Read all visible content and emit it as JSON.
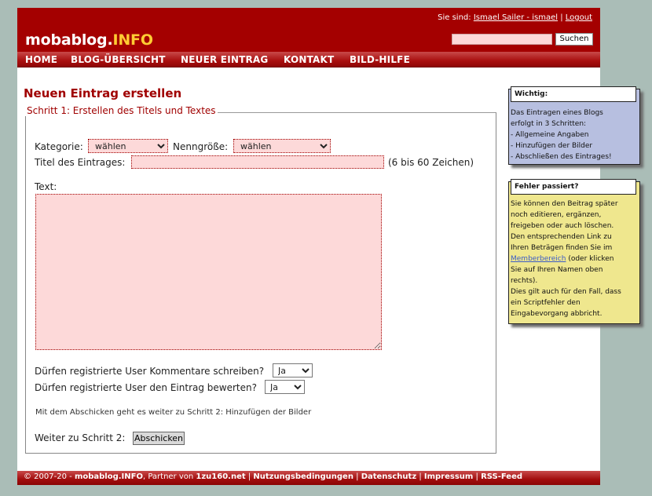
{
  "header": {
    "logo_main": "mobablog.",
    "logo_accent": "INFO",
    "user_prefix": "Sie sind:",
    "user_link": "Ismael Sailer - ismael",
    "separator": "|",
    "logout": "Logout",
    "search_value": "",
    "search_button": "Suchen"
  },
  "nav": {
    "home": "HOME",
    "blog": "BLOG-ÜBERSICHT",
    "new": "NEUER EINTRAG",
    "contact": "KONTAKT",
    "help": "BILD-HILFE"
  },
  "main": {
    "title": "Neuen Eintrag erstellen",
    "legend": "Schritt 1: Erstellen des Titels und Textes",
    "category_label": "Kategorie:",
    "category_value": "wählen",
    "size_label": "Nenngröße:",
    "size_value": "wählen",
    "title_label": "Titel des Eintrages:",
    "title_value": "",
    "title_hint": "(6 bis 60 Zeichen)",
    "text_label": "Text:",
    "comments_label": "Dürfen registrierte User Kommentare schreiben?",
    "comments_value": "Ja",
    "rating_label": "Dürfen registrierte User den Eintrag bewerten?",
    "rating_value": "Ja",
    "info_small": "Mit dem Abschicken geht es weiter zu Schritt 2: Hinzufügen der Bilder",
    "next_label": "Weiter zu Schritt 2:",
    "submit": "Abschicken"
  },
  "sidebar": {
    "wichtig_title": "Wichtig:",
    "wichtig_lines": [
      "Das Eintragen eines Blogs",
      "erfolgt in 3 Schritten:",
      "- Allgemeine Angaben",
      "- Hinzufügen der Bilder",
      "- Abschließen des Eintrages!"
    ],
    "fehler_title": "Fehler passiert?",
    "fehler_lines": [
      "Sie können den Beitrag später",
      "noch editieren, ergänzen,",
      "freigeben oder auch löschen.",
      "Den entsprechenden Link zu",
      "Ihren Beträgen finden Sie im"
    ],
    "fehler_link": "Memberbereich",
    "fehler_after_link": " (oder klicken",
    "fehler_lines2": [
      "Sie auf Ihren Namen oben",
      "rechts).",
      "Dies gilt auch für den Fall, dass",
      "ein Scriptfehler den",
      "Eingabevorgang abbricht."
    ]
  },
  "footer": {
    "copyright": "© 2007-20 - ",
    "site": "mobablog.INFO",
    "partner_text": ", Partner von ",
    "partner": "1zu160.net",
    "sep": " | ",
    "terms": "Nutzungsbedingungen",
    "privacy": "Datenschutz",
    "imprint": "Impressum",
    "rss": "RSS-Feed"
  }
}
